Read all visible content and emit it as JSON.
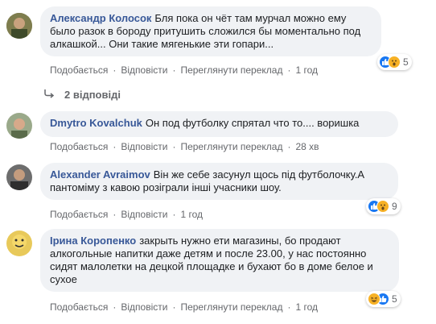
{
  "comments": [
    {
      "author": "Александр Колосок",
      "text": "Бля пока он чёт там мурчал можно ему было разок в бороду притушить сложился бы моментально под алкашкой... Они такие мягенькие эти гопари...",
      "actions": [
        "Подобається",
        "Відповісти",
        "Переглянути переклад"
      ],
      "time": "1 год",
      "reaction_count": "5",
      "reactions": [
        "like-icon",
        "wow-icon"
      ]
    },
    {
      "author": "Dmytro Kovalchuk",
      "text": "Он под футболку спрятал что то.... воришка",
      "actions": [
        "Подобається",
        "Відповісти",
        "Переглянути переклад"
      ],
      "time": "28 хв"
    },
    {
      "author": "Alexander Avraimov",
      "text": "Він же себе засунул щось під футболочку.А пантоміму з кавою розіграли інші учасники шоу.",
      "actions": [
        "Подобається",
        "Відповісти"
      ],
      "time": "1 год",
      "reaction_count": "9",
      "reactions": [
        "like-icon",
        "wow-icon"
      ]
    },
    {
      "author": "Ірина Коропенко",
      "text": "закрыть нужно ети магазины, бо продают алкогольные напитки даже детям и после 23.00, у нас постоянно сидят малолетки на децкой площадке и бухают бо в доме белое и сухое",
      "actions": [
        "Подобається",
        "Відповісти",
        "Переглянути переклад"
      ],
      "time": "1 год",
      "reaction_count": "5",
      "reactions": [
        "haha-icon",
        "like-icon"
      ]
    }
  ],
  "replies_label": "2 відповіді",
  "colors": {
    "bubble_bg": "#f0f2f5",
    "author": "#385898",
    "meta": "#65676b",
    "like": "#1877f2",
    "emoji": "#f7b125"
  }
}
